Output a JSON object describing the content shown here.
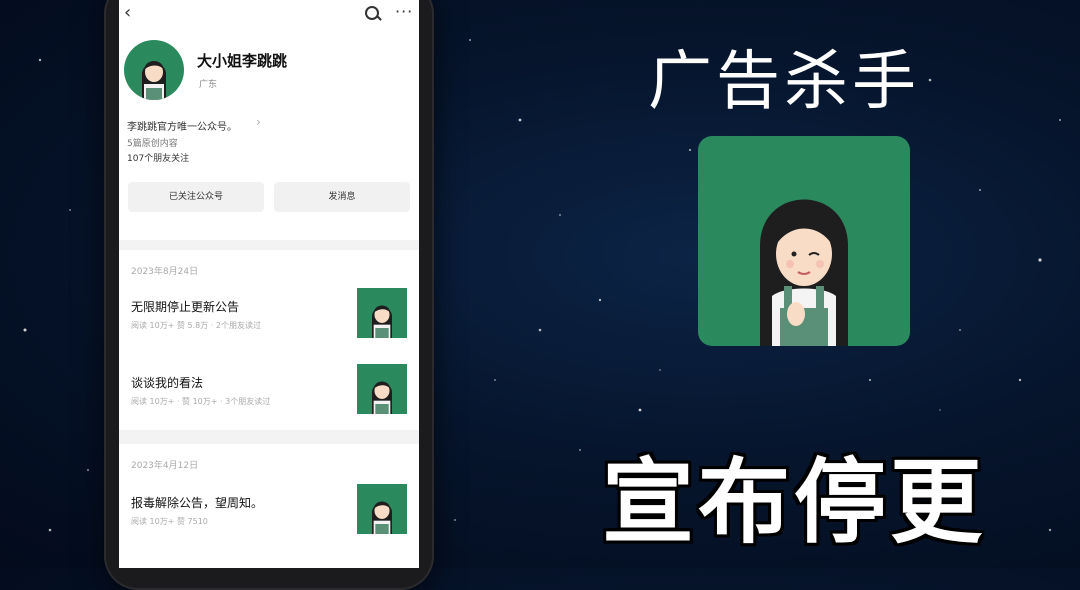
{
  "colors": {
    "brand_green": "#2a8a5e",
    "bg_dark": "#06152d"
  },
  "header": {
    "back_icon": "back-chevron-icon",
    "search_icon": "search-icon",
    "more_icon": "more-dots-icon",
    "more_label": "···"
  },
  "profile": {
    "name": "大小姐李跳跳",
    "region": "广东",
    "description": "李跳跳官方唯一公众号。",
    "originals": "5篇原创内容",
    "friends": "107个朋友关注",
    "follow_button": "已关注公众号",
    "message_button": "发消息"
  },
  "feed": [
    {
      "date": "2023年8月24日",
      "articles": [
        {
          "title": "无限期停止更新公告",
          "meta": "阅读 10万+   赞 5.8万 · 2个朋友读过"
        },
        {
          "title": "谈谈我的看法",
          "meta": "阅读 10万+ · 赞 10万+ · 3个朋友读过"
        }
      ]
    },
    {
      "date": "2023年4月12日",
      "articles": [
        {
          "title": "报毒解除公告，望周知。",
          "meta": "阅读 10万+   赞 7510"
        }
      ]
    }
  ],
  "overlay": {
    "title": "广告杀手",
    "banner": "宣布停更"
  }
}
